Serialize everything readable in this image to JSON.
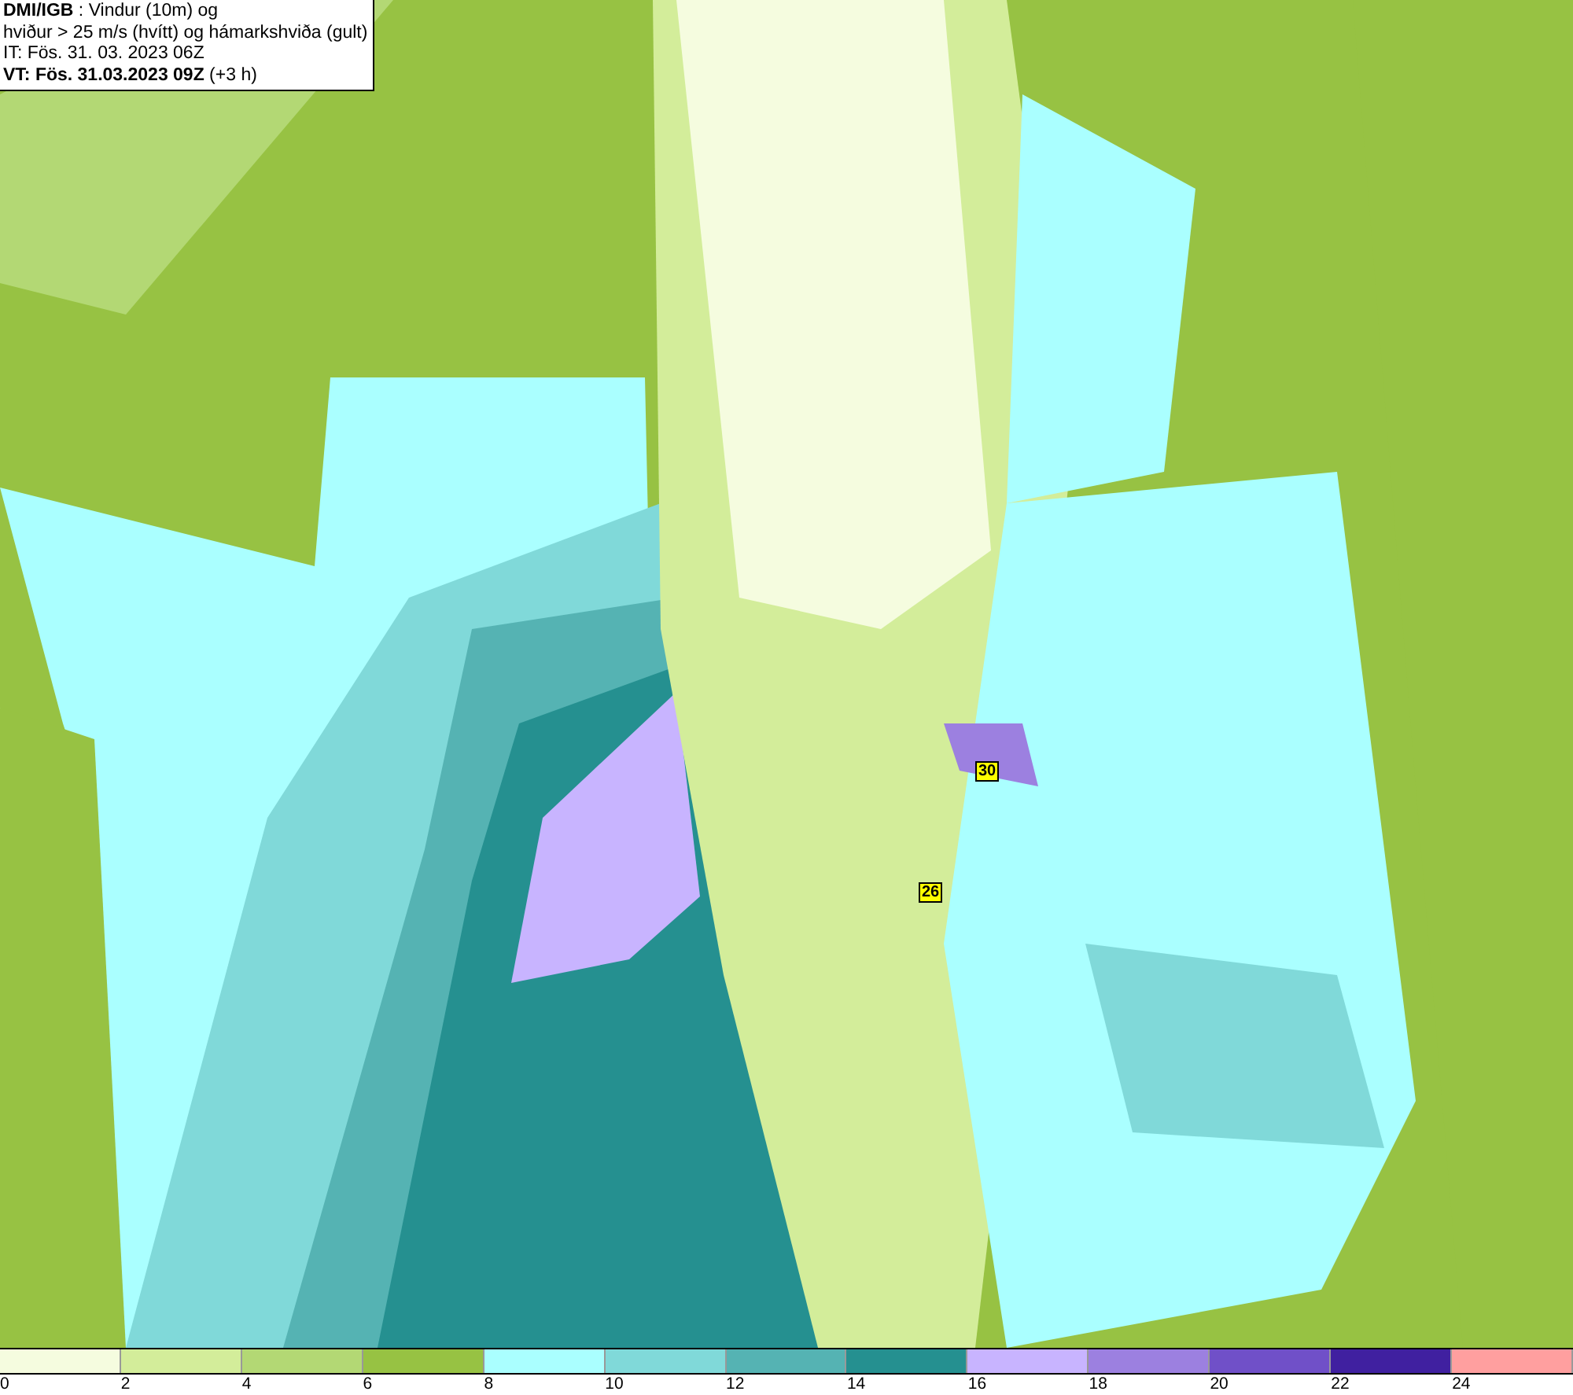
{
  "header": {
    "lines": [
      "**DMI/IGB** : Vindur (10m) og",
      "hviður > 25 m/s (hvítt) og hámarkshviða (gult)",
      "IT: Fös. 31. 03. 2023 06Z",
      "**VT: Fös. 31.03.2023 09Z** (+3 h)"
    ]
  },
  "map": {
    "gust_labels": [
      "30",
      "26"
    ]
  },
  "legend": {
    "bins": [
      {
        "color": "#f5fcdf"
      },
      {
        "color": "#d3ed9a"
      },
      {
        "color": "#b3d874"
      },
      {
        "color": "#97c243"
      },
      {
        "color": "#aaffff"
      },
      {
        "color": "#80d9d9"
      },
      {
        "color": "#55b3b3"
      },
      {
        "color": "#259090"
      },
      {
        "color": "#c8b4ff"
      },
      {
        "color": "#9c80e0"
      },
      {
        "color": "#7050c8"
      },
      {
        "color": "#4020a0"
      },
      {
        "color": "#ff9f9f"
      }
    ],
    "ticks": [
      "0",
      "2",
      "4",
      "6",
      "8",
      "10",
      "12",
      "14",
      "16",
      "18",
      "20",
      "22",
      "24"
    ]
  }
}
